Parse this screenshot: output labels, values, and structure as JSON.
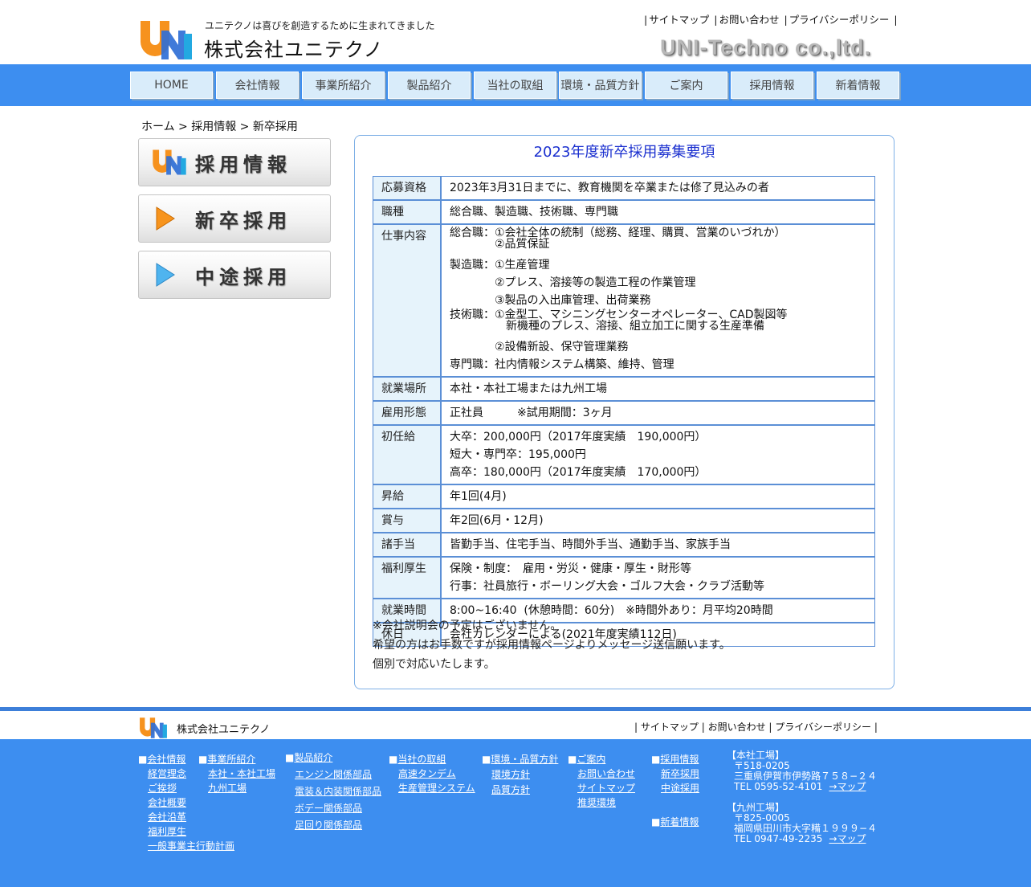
{
  "header": {
    "tagline": "ユニテクノは喜びを創造するために生まれてきました",
    "company_name": "株式会社ユニテクノ",
    "brand_en": "UNI-Techno co.,ltd.",
    "top_links": [
      "サイトマップ",
      "お問い合わせ",
      "プライバシーポリシー"
    ]
  },
  "nav": [
    "HOME",
    "会社情報",
    "事業所紹介",
    "製品紹介",
    "当社の取組",
    "環境・品質方針",
    "ご案内",
    "採用情報",
    "新着情報"
  ],
  "breadcrumb": "ホーム > 採用情報 > 新卒採用",
  "sidebar": {
    "buttons": [
      {
        "label": "採用情報",
        "icon": "uni-logo-icon"
      },
      {
        "label": "新卒採用",
        "icon": "orange-play-icon"
      },
      {
        "label": "中途採用",
        "icon": "blue-play-icon"
      }
    ]
  },
  "content": {
    "title": "2023年度新卒採用募集要項",
    "rows": [
      {
        "key": "応募資格",
        "lines": [
          "2023年3月31日までに、教育機関を卒業または修了見込みの者"
        ]
      },
      {
        "key": "職種",
        "lines": [
          "総合職、製造職、技術職、専門職"
        ]
      },
      {
        "key": "仕事内容",
        "lines": [
          "総合職：①会社全体の統制（総務、経理、購買、営業のいづれか）",
          "　　　　②品質保証",
          "製造職：①生産管理",
          "　　　　②プレス、溶接等の製造工程の作業管理",
          "　　　　③製品の入出庫管理、出荷業務",
          "技術職：①金型工、マシニングセンターオペレーター、CAD製図等",
          "　　　　　新機種のプレス、溶接、組立加工に関する生産準備",
          "　　　　②設備新設、保守管理業務",
          "専門職：社内情報システム構築、維持、管理"
        ]
      },
      {
        "key": "就業場所",
        "lines": [
          "本社・本社工場または九州工場"
        ]
      },
      {
        "key": "雇用形態",
        "lines": [
          "正社員　　　※試用期間：3ヶ月"
        ]
      },
      {
        "key": "初任給",
        "lines": [
          "大卒：200,000円（2017年度実績　190,000円）",
          "短大・専門卒：195,000円",
          "高卒：180,000円（2017年度実績　170,000円）"
        ]
      },
      {
        "key": "昇給",
        "lines": [
          "年1回(4月)"
        ]
      },
      {
        "key": "賞与",
        "lines": [
          "年2回(6月・12月)"
        ]
      },
      {
        "key": "諸手当",
        "lines": [
          "皆勤手当、住宅手当、時間外手当、通勤手当、家族手当"
        ]
      },
      {
        "key": "福利厚生",
        "lines": [
          "保険・制度：　雇用・労災・健康・厚生・財形等",
          "行事：社員旅行・ボーリング大会・ゴルフ大会・クラブ活動等"
        ]
      },
      {
        "key": "就業時間",
        "lines": [
          "8:00~16:40  (休憩時間：60分)　※時間外あり：月平均20時間"
        ]
      },
      {
        "key": "休日",
        "lines": [
          "会社カレンダーによる(2021年度実績112日)"
        ]
      }
    ],
    "notes": [
      "※会社説明会の予定はございません。",
      "希望の方はお手数ですが採用情報ページよりメッセージ送信願います。",
      "個別で対応いたします。"
    ]
  },
  "footer": {
    "company_name": "株式会社ユニテクノ",
    "links": [
      "サイトマップ",
      "お問い合わせ",
      "プライバシーポリシー"
    ],
    "columns": [
      {
        "head": "会社情報",
        "items": [
          "経営理念",
          "ご挨拶",
          "会社概要",
          "会社沿革",
          "福利厚生",
          "一般事業主行動計画"
        ]
      },
      {
        "head": "事業所紹介",
        "items": [
          "本社・本社工場",
          "九州工場"
        ]
      },
      {
        "head": "製品紹介",
        "items": [
          "エンジン関係部品",
          "電装＆内装関係部品",
          "ボデー関係部品",
          "足回り関係部品"
        ]
      },
      {
        "head": "当社の取組",
        "items": [
          "高速タンデム",
          "生産管理システム"
        ]
      },
      {
        "head": "環境・品質方針",
        "items": [
          "環境方針",
          "品質方針"
        ]
      },
      {
        "head": "ご案内",
        "items": [
          "お問い合わせ",
          "サイトマップ",
          "推奨環境"
        ]
      },
      {
        "head": "採用情報",
        "items": [
          "新卒採用",
          "中途採用"
        ]
      },
      {
        "head": "新着情報",
        "items": []
      }
    ],
    "honsha": {
      "title": "【本社工場】",
      "zip": "〒518-0205",
      "address": "三重県伊賀市伊勢路７５８−２４",
      "tel": "TEL 0595-52-4101",
      "map": "→マップ"
    },
    "kyushu": {
      "title": "【九州工場】",
      "zip": "〒825-0005",
      "address": "福岡県田川市大字糒１９９９−４",
      "tel": "TEL 0947-49-2235",
      "map": "→マップ"
    }
  }
}
